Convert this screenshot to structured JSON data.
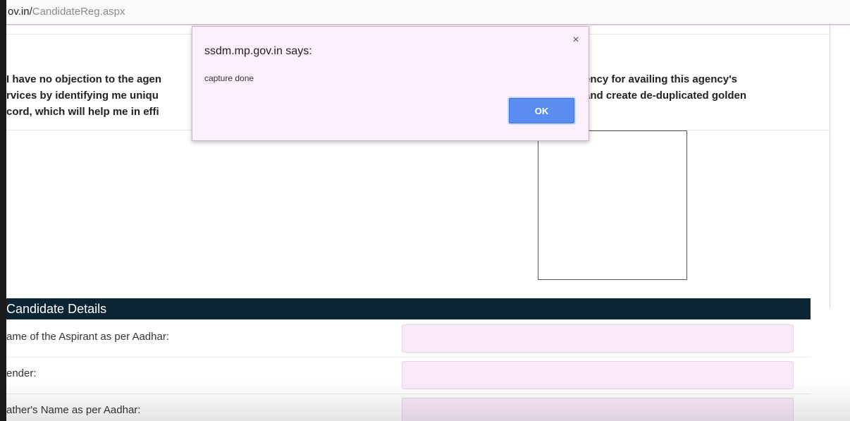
{
  "browser": {
    "url_domain": "ov.in/",
    "url_path": "CandidateReg.aspx"
  },
  "consent": {
    "line1_left": "I have no objection to the agen",
    "line1_right": "ency for availing this agency's",
    "line2_left": "rvices by identifying me uniqu",
    "line2_right": "and create de-duplicated golden",
    "line3_left": "cord, which will help me in effi"
  },
  "section": {
    "title": "Candidate Details"
  },
  "form": {
    "rows": [
      {
        "label": "ame of the Aspirant as per Aadhar:",
        "value": ""
      },
      {
        "label": "ender:",
        "value": ""
      },
      {
        "label": "ather's Name as per Aadhar:",
        "value": ""
      }
    ]
  },
  "dialog": {
    "title": "ssdm.mp.gov.in says:",
    "message": "capture done",
    "ok_label": "OK",
    "close_symbol": "×"
  }
}
